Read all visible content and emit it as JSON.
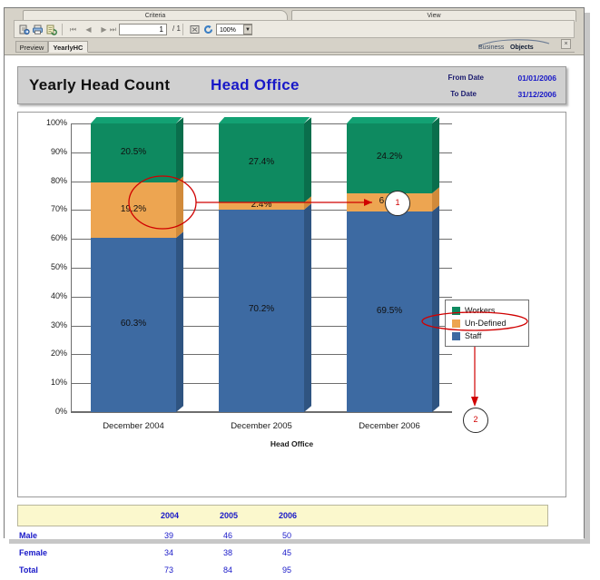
{
  "window": {
    "panels": {
      "criteria": "Criteria",
      "view": "View"
    },
    "toolbar": {
      "icons": [
        "export-icon",
        "print-icon",
        "refresh-icon",
        "stop-icon",
        "refresh-data-icon",
        "find-icon"
      ],
      "nav": {
        "first": "⏮",
        "prev": "◀",
        "next": "▶",
        "last": "⏭"
      },
      "page_value": "1",
      "page_total": "/ 1",
      "zoom_value": "100%",
      "zoom_caret": "▼"
    },
    "tabs": [
      {
        "label": "Preview",
        "active": false
      },
      {
        "label": "YearlyHC",
        "active": true
      }
    ],
    "brand": {
      "word1": "Business",
      "word2": "Objects"
    },
    "close_label": "×"
  },
  "report": {
    "title": "Yearly Head Count",
    "office": "Head Office",
    "from_label": "From Date",
    "from_date": "01/01/2006",
    "to_label": "To Date",
    "to_date": "31/12/2006"
  },
  "colors": {
    "workers": "#0e8a60",
    "workers_top": "#13a173",
    "workers_side": "#0a6e4c",
    "undefined": "#eda551",
    "undefined_top": "#f3bb78",
    "undefined_side": "#d18a3a",
    "staff": "#3d6aa2",
    "staff_top": "#5b86ba",
    "staff_side": "#2f5481",
    "annotation": "#d00000",
    "title_blue": "#1818c8",
    "table_header": "#fbf8cd"
  },
  "chart_data": {
    "type": "bar",
    "subtype": "stacked-100-percent-3d",
    "title": "Yearly Head Count",
    "xlabel": "Head Office",
    "ylabel": "",
    "ylim": [
      0,
      100
    ],
    "ytick_labels": [
      "0%",
      "10%",
      "20%",
      "30%",
      "40%",
      "50%",
      "60%",
      "70%",
      "80%",
      "90%",
      "100%"
    ],
    "grid": true,
    "legend_position": "right",
    "categories": [
      "December 2004",
      "December 2005",
      "December 2006"
    ],
    "series": [
      {
        "name": "Workers",
        "color": "#0e8a60",
        "values": [
          20.5,
          27.4,
          24.2
        ],
        "labels": [
          "20.5%",
          "27.4%",
          "24.2%"
        ]
      },
      {
        "name": "Un-Defined",
        "color": "#eda551",
        "values": [
          19.2,
          2.4,
          6.3
        ],
        "labels": [
          "19.2%",
          "2.4%",
          "6.3%"
        ]
      },
      {
        "name": "Staff",
        "color": "#3d6aa2",
        "values": [
          60.3,
          70.2,
          69.5
        ],
        "labels": [
          "60.3%",
          "70.2%",
          "69.5%"
        ]
      }
    ],
    "annotations": [
      {
        "id": "1",
        "label": "1",
        "target": "undefined-segment-2006",
        "note": "red ellipse around 6.3% Un-Defined segment with arrow to callout 1"
      },
      {
        "id": "2",
        "label": "2",
        "target": "legend-undefined",
        "note": "red ellipse around Un-Defined legend entry with arrow down to callout 2"
      }
    ]
  },
  "table": {
    "columns": [
      "",
      "2004",
      "2005",
      "2006"
    ],
    "rows": [
      {
        "label": "Male",
        "values": [
          "39",
          "46",
          "50"
        ]
      },
      {
        "label": "Female",
        "values": [
          "34",
          "38",
          "45"
        ]
      },
      {
        "label": "Total",
        "values": [
          "73",
          "84",
          "95"
        ]
      }
    ]
  }
}
